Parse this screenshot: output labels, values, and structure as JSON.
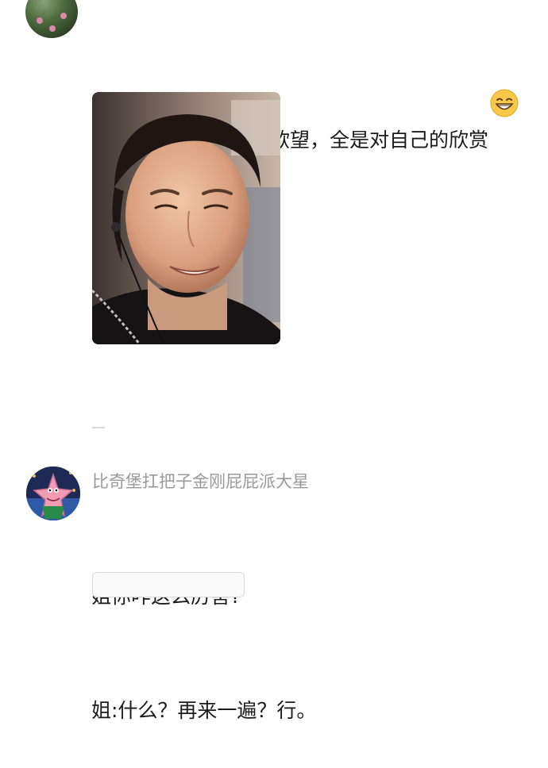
{
  "comments": [
    {
      "text": "眼里没有一点对钱的欲望，全是对自己的欣赏",
      "emoji": "grinning-face-emoji",
      "photo": "smiling-woman-photo"
    },
    {
      "username": "比奇堡扛把子金刚屁屁派大星",
      "lines": [
        "姐你咋这么厉害?",
        "姐:什么？再来一遍？行。"
      ]
    }
  ]
}
